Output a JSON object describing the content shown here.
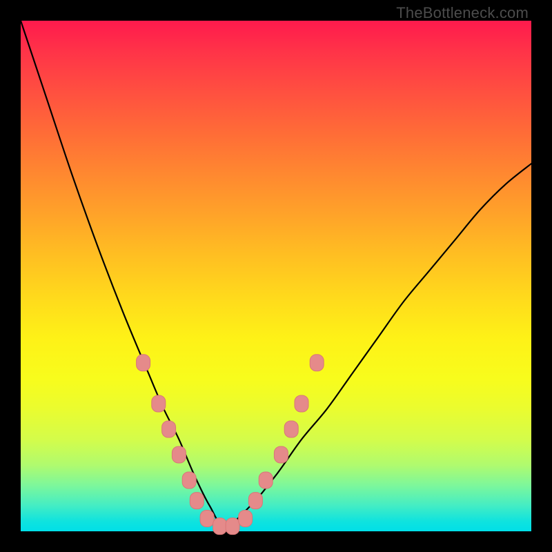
{
  "watermark": "TheBottleneck.com",
  "colors": {
    "frame": "#000000",
    "curve": "#000000",
    "marker_fill": "#e58a8a",
    "marker_stroke": "#d87777",
    "gradient_top": "#ff1a4d",
    "gradient_bottom": "#00dfe8"
  },
  "chart_data": {
    "type": "line",
    "title": "",
    "xlabel": "",
    "ylabel": "",
    "xlim": [
      0,
      100
    ],
    "ylim": [
      0,
      100
    ],
    "note": "V-shaped bottleneck curve; x is normalized component balance, y is normalized bottleneck percentage; axes hidden; background encodes y as rainbow (red=high, green=low)",
    "series": [
      {
        "name": "bottleneck-curve",
        "x": [
          0,
          5,
          10,
          15,
          20,
          25,
          28,
          31,
          34,
          37,
          40,
          45,
          50,
          55,
          60,
          65,
          70,
          75,
          80,
          85,
          90,
          95,
          100
        ],
        "y": [
          100,
          85,
          70,
          56,
          43,
          31,
          24,
          18,
          11,
          5,
          1,
          5,
          11,
          18,
          24,
          31,
          38,
          45,
          51,
          57,
          63,
          68,
          72
        ]
      }
    ],
    "markers": {
      "name": "highlighted-points",
      "shape": "rounded-rect",
      "points": [
        {
          "x": 24,
          "y": 33
        },
        {
          "x": 27,
          "y": 25
        },
        {
          "x": 29,
          "y": 20
        },
        {
          "x": 31,
          "y": 15
        },
        {
          "x": 33,
          "y": 10
        },
        {
          "x": 34.5,
          "y": 6
        },
        {
          "x": 36.5,
          "y": 2.5
        },
        {
          "x": 39,
          "y": 1
        },
        {
          "x": 41.5,
          "y": 1
        },
        {
          "x": 44,
          "y": 2.5
        },
        {
          "x": 46,
          "y": 6
        },
        {
          "x": 48,
          "y": 10
        },
        {
          "x": 51,
          "y": 15
        },
        {
          "x": 53,
          "y": 20
        },
        {
          "x": 55,
          "y": 25
        },
        {
          "x": 58,
          "y": 33
        }
      ]
    }
  }
}
